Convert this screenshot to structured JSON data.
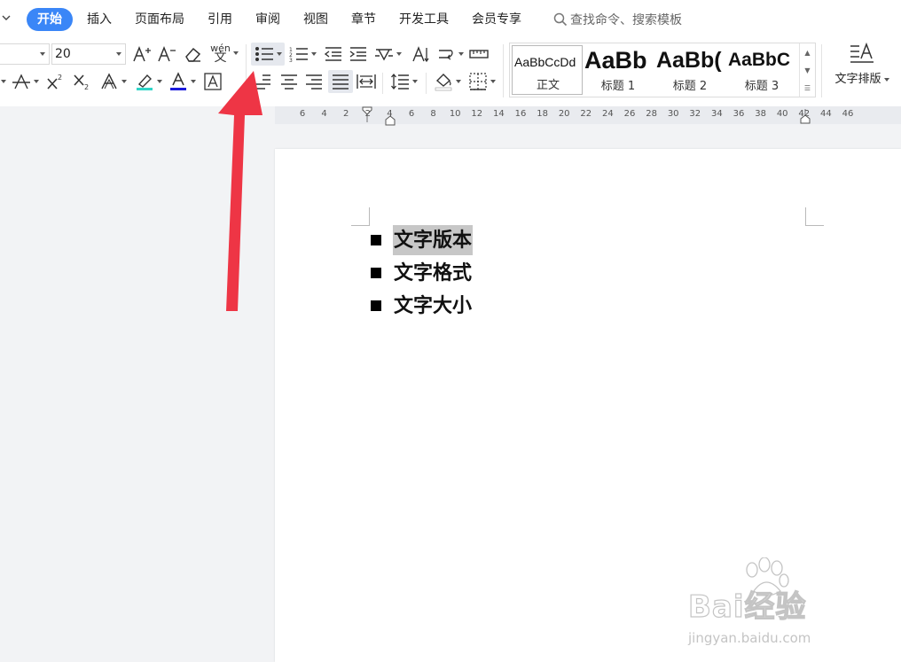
{
  "menu": {
    "tabs": [
      {
        "label": "开始",
        "active": true
      },
      {
        "label": "插入"
      },
      {
        "label": "页面布局"
      },
      {
        "label": "引用"
      },
      {
        "label": "审阅"
      },
      {
        "label": "视图"
      },
      {
        "label": "章节"
      },
      {
        "label": "开发工具"
      },
      {
        "label": "会员专享"
      }
    ],
    "search_placeholder": "查找命令、搜索模板"
  },
  "ribbon": {
    "font_size": "20",
    "pinyin_label": "wén",
    "pinyin_char": "文",
    "styles": [
      {
        "sample": "AaBbCcDd",
        "name": "正文"
      },
      {
        "sample": "AaBb",
        "name": "标题 1"
      },
      {
        "sample": "AaBb(",
        "name": "标题 2"
      },
      {
        "sample": "AaBbC",
        "name": "标题 3"
      }
    ],
    "text_layout_label": "文字排版"
  },
  "ruler": {
    "labels": [
      "6",
      "4",
      "2",
      "2",
      "4",
      "6",
      "8",
      "10",
      "12",
      "14",
      "16",
      "18",
      "20",
      "22",
      "24",
      "26",
      "28",
      "30",
      "32",
      "34",
      "36",
      "38",
      "40",
      "42",
      "44",
      "46"
    ]
  },
  "document": {
    "items": [
      {
        "text": "文字版本",
        "selected": true
      },
      {
        "text": "文字格式",
        "selected": false
      },
      {
        "text": "文字大小",
        "selected": false
      }
    ]
  },
  "watermark": {
    "brand": "Bai经验",
    "url": "jingyan.baidu.com"
  },
  "colors": {
    "accent": "#3a86f7",
    "arrow": "#ee3545",
    "highlight_bar": "#30d5c8",
    "font_color_bar": "#1a1adc"
  }
}
